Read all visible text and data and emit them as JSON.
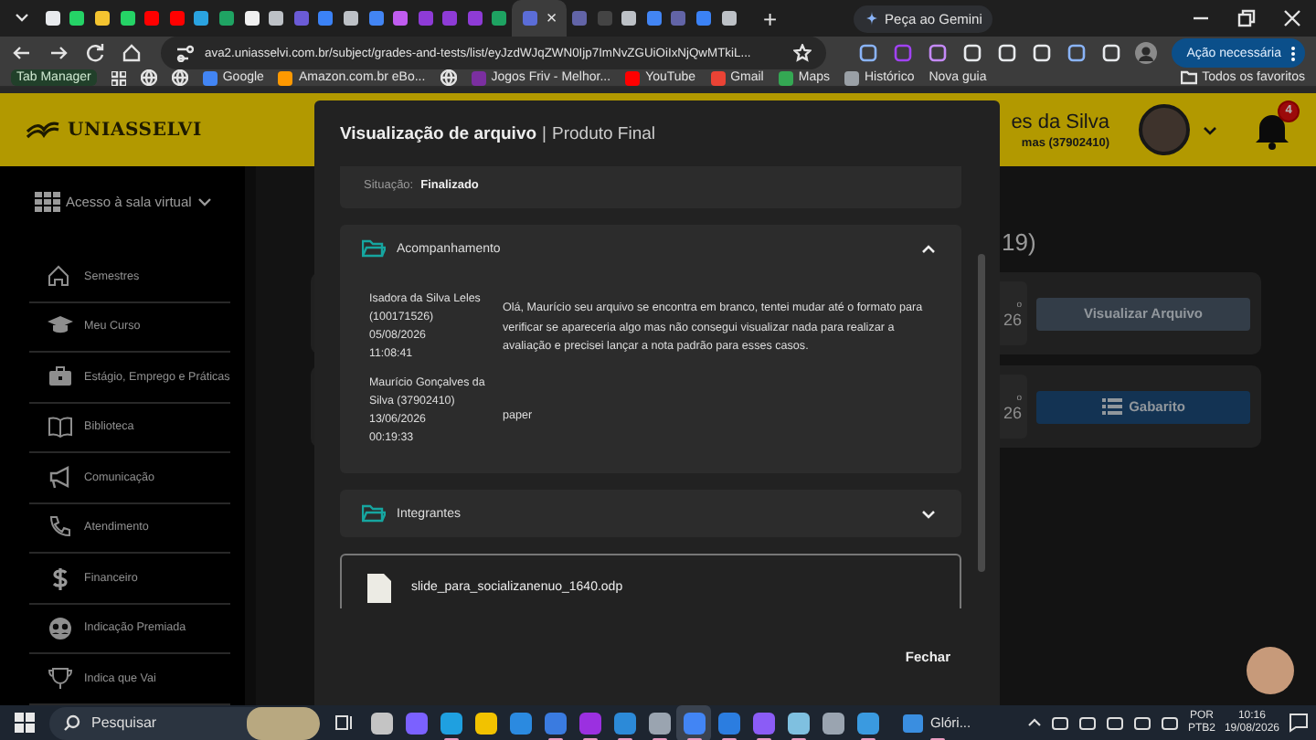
{
  "browser": {
    "tabs": [
      {
        "color": "#e8eaed",
        "selected": false
      },
      {
        "color": "#25d366",
        "selected": false
      },
      {
        "color": "#f4c430",
        "selected": false
      },
      {
        "color": "#25d366",
        "selected": false
      },
      {
        "color": "#ff0000",
        "selected": false
      },
      {
        "color": "#ff0000",
        "selected": false
      },
      {
        "color": "#2aa3e0",
        "selected": false
      },
      {
        "color": "#1fa463",
        "selected": false
      },
      {
        "color": "#f0f0f0",
        "selected": false
      },
      {
        "color": "#bdc1c6",
        "selected": false
      },
      {
        "color": "#6b5bd6",
        "selected": false
      },
      {
        "color": "#3b82f6",
        "selected": false
      },
      {
        "color": "#bdc1c6",
        "selected": false
      },
      {
        "color": "#4285f4",
        "selected": false
      },
      {
        "color": "#c05cf0",
        "selected": false
      },
      {
        "color": "#8e3bd6",
        "selected": false
      },
      {
        "color": "#8e3bd6",
        "selected": false
      },
      {
        "color": "#8e3bd6",
        "selected": false
      },
      {
        "color": "#1ea362",
        "selected": false
      },
      {
        "color": "#5b6dd8",
        "selected": true
      },
      {
        "color": "#6264a7",
        "selected": false
      },
      {
        "color": "#444444",
        "selected": false
      },
      {
        "color": "#bdc1c6",
        "selected": false
      },
      {
        "color": "#4285f4",
        "selected": false
      },
      {
        "color": "#6264a7",
        "selected": false
      },
      {
        "color": "#3b82f6",
        "selected": false
      },
      {
        "color": "#bdc1c6",
        "selected": false
      }
    ],
    "tab_close": "×",
    "new_tab": "+",
    "gemini_button": "Peça ao Gemini",
    "url": "ava2.uniasselvi.com.br/subject/grades-and-tests/list/eyJzdWJqZWN0Ijp7ImNvZGUiOiIxNjQwMTkiL...",
    "action_button": "Ação necessária",
    "bookmarks": [
      {
        "kind": "text",
        "label": "Tab Manager"
      },
      {
        "kind": "apps"
      },
      {
        "kind": "globe"
      },
      {
        "kind": "globe"
      },
      {
        "kind": "link",
        "label": "Google",
        "color": "#4285f4"
      },
      {
        "kind": "link",
        "label": "Amazon.com.br eBo...",
        "color": "#ff9900"
      },
      {
        "kind": "globe"
      },
      {
        "kind": "link",
        "label": "Jogos Friv - Melhor...",
        "color": "#7b2fa0"
      },
      {
        "kind": "link",
        "label": "YouTube",
        "color": "#ff0000"
      },
      {
        "kind": "link",
        "label": "Gmail",
        "color": "#ea4335"
      },
      {
        "kind": "link",
        "label": "Maps",
        "color": "#34a853"
      },
      {
        "kind": "link",
        "label": "Histórico",
        "color": "#9aa0a6"
      },
      {
        "kind": "plain",
        "label": "Nova guia"
      }
    ],
    "all_bookmarks": "Todos os favoritos"
  },
  "header": {
    "logo": "UNIASSELVI",
    "user_name": "es da Silva",
    "user_detail": "mas (37902410)",
    "notifications": "4"
  },
  "sidebar": {
    "access_menu": "Acesso à sala virtual",
    "items": [
      {
        "kind": "home",
        "label": "Semestres"
      },
      {
        "kind": "cap",
        "label": "Meu Curso"
      },
      {
        "kind": "briefcase",
        "label": "Estágio, Emprego e Práticas"
      },
      {
        "kind": "book",
        "label": "Biblioteca"
      },
      {
        "kind": "megaphone",
        "label": "Comunicação"
      },
      {
        "kind": "phone",
        "label": "Atendimento"
      },
      {
        "kind": "dollar",
        "label": "Financeiro"
      },
      {
        "kind": "group",
        "label": "Indicação Premiada"
      },
      {
        "kind": "trophy",
        "label": "Indica que Vai"
      }
    ]
  },
  "main": {
    "heading": "19)",
    "cards": [
      {
        "label": "o",
        "value": "26",
        "button": "Visualizar Arquivo",
        "kind": "secondary"
      },
      {
        "label": "o",
        "value": "26",
        "button": "Gabarito",
        "kind": "primary"
      }
    ]
  },
  "modal": {
    "title": "Visualização de arquivo",
    "separator": "|",
    "subtitle": "Produto Final",
    "status_label": "Situação:",
    "status_value": "Finalizado",
    "sections": [
      {
        "title": "Acompanhamento",
        "expanded": true,
        "messages": [
          {
            "author": "Isadora da Silva Leles (100171526)",
            "date": "05/08/2026",
            "time": "11:08:41",
            "text": "Olá, Maurício seu arquivo se encontra em branco, tentei mudar até o formato para verificar se apareceria algo mas não consegui visualizar nada para realizar a avaliação e precisei lançar a nota padrão para esses casos."
          },
          {
            "author": "Maurício Gonçalves da Silva (37902410)",
            "date": "13/06/2026",
            "time": "00:19:33",
            "text": "paper"
          }
        ]
      },
      {
        "title": "Integrantes",
        "expanded": false
      }
    ],
    "file": "slide_para_socializanenuo_1640.odp",
    "close_button": "Fechar"
  },
  "taskbar": {
    "search": "Pesquisar",
    "apps": [
      {
        "color": "#c4c4c4",
        "selected": false,
        "running": false
      },
      {
        "color": "#7b61ff",
        "selected": false,
        "running": false
      },
      {
        "color": "#1fa0e0",
        "selected": false,
        "running": true
      },
      {
        "color": "#f2c200",
        "selected": false,
        "running": false
      },
      {
        "color": "#2b8ae0",
        "selected": false,
        "running": false
      },
      {
        "color": "#3a7be0",
        "selected": false,
        "running": true
      },
      {
        "color": "#9b30e0",
        "selected": false,
        "running": true
      },
      {
        "color": "#2c8ad8",
        "selected": false,
        "running": true
      },
      {
        "color": "#9aa4b0",
        "selected": false,
        "running": true
      },
      {
        "color": "#4285f4",
        "selected": true,
        "running": true
      },
      {
        "color": "#2b7de0",
        "selected": false,
        "running": true
      },
      {
        "color": "#8b5cf6",
        "selected": false,
        "running": true
      },
      {
        "color": "#7fc0e0",
        "selected": false,
        "running": true
      },
      {
        "color": "#9aa4b0",
        "selected": false,
        "running": false
      },
      {
        "color": "#3a9ae0",
        "selected": false,
        "running": true
      }
    ],
    "window_label": "Glóri...",
    "language": "POR",
    "layout": "PTB2",
    "time": "10:16",
    "date": "19/08/2026"
  }
}
